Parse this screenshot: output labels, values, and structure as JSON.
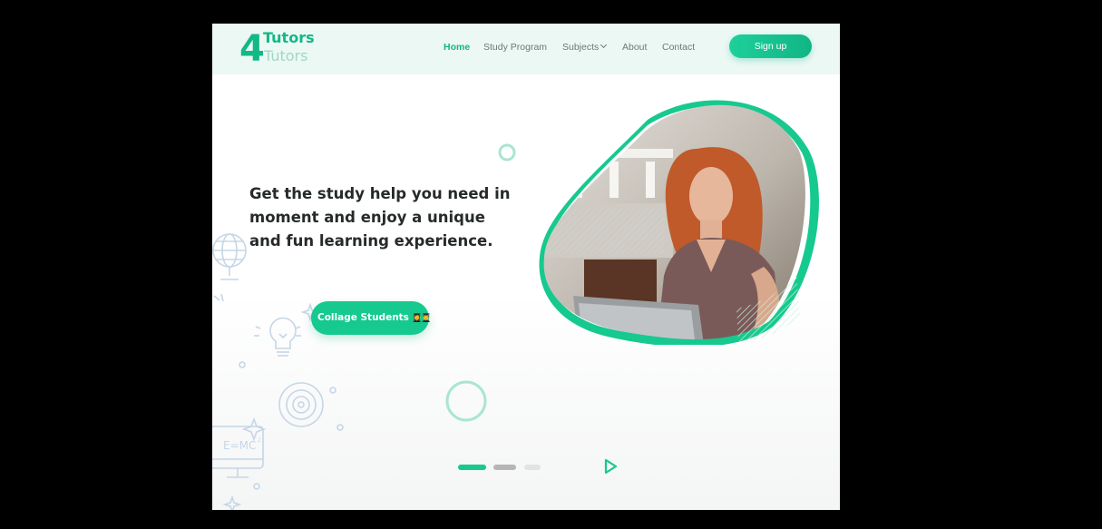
{
  "logo": {
    "number": "4",
    "line1": "Tutors",
    "line2": "Tutors"
  },
  "nav": {
    "items": [
      {
        "label": "Home",
        "active": true
      },
      {
        "label": "Study Program",
        "active": false
      },
      {
        "label": "Subjects",
        "active": false,
        "has_dropdown": true
      },
      {
        "label": "About",
        "active": false
      },
      {
        "label": "Contact",
        "active": false
      }
    ],
    "signup_label": "Sign up"
  },
  "hero": {
    "headline_lines": [
      "Get the study help you need in",
      "moment and enjoy a unique",
      "and fun learning experience."
    ],
    "cta_label": "Collage Students",
    "cta_emoji": "👩‍🎓👨‍🎓",
    "photo_icon": "woman-laptop-photo"
  },
  "slider": {
    "dot_count": 3,
    "active_index": 0,
    "play_icon": "play-icon"
  },
  "colors": {
    "accent": "#12b886",
    "header_bg": "#ebf8f4",
    "headline": "#262b2a",
    "nav_text": "#6b7a76",
    "decor_line": "#c6d6e6"
  }
}
